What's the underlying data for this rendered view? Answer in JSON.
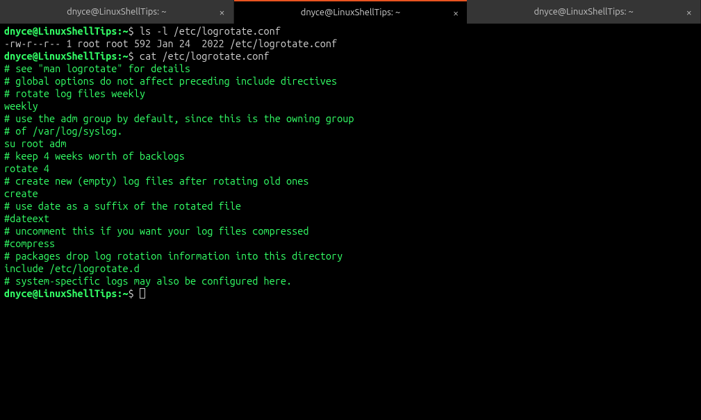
{
  "tabs": [
    {
      "title": "dnyce@LinuxShellTips: ~",
      "active": false
    },
    {
      "title": "dnyce@LinuxShellTips: ~",
      "active": true
    },
    {
      "title": "dnyce@LinuxShellTips: ~",
      "active": false
    }
  ],
  "prompt": {
    "user_host": "dnyce@LinuxShellTips",
    "sep": ":",
    "path": "~",
    "symbol": "$"
  },
  "commands": {
    "cmd1": "ls -l /etc/logrotate.conf",
    "cmd2": "cat /etc/logrotate.conf"
  },
  "output": {
    "ls": "-rw-r--r-- 1 root root 592 Jan 24  2022 /etc/logrotate.conf"
  },
  "file_lines": [
    "# see \"man logrotate\" for details",
    "",
    "# global options do not affect preceding include directives",
    "",
    "# rotate log files weekly",
    "weekly",
    "",
    "# use the adm group by default, since this is the owning group",
    "# of /var/log/syslog.",
    "su root adm",
    "",
    "# keep 4 weeks worth of backlogs",
    "rotate 4",
    "",
    "# create new (empty) log files after rotating old ones",
    "create",
    "",
    "# use date as a suffix of the rotated file",
    "#dateext",
    "",
    "# uncomment this if you want your log files compressed",
    "#compress",
    "",
    "# packages drop log rotation information into this directory",
    "include /etc/logrotate.d",
    "",
    "# system-specific logs may also be configured here."
  ]
}
